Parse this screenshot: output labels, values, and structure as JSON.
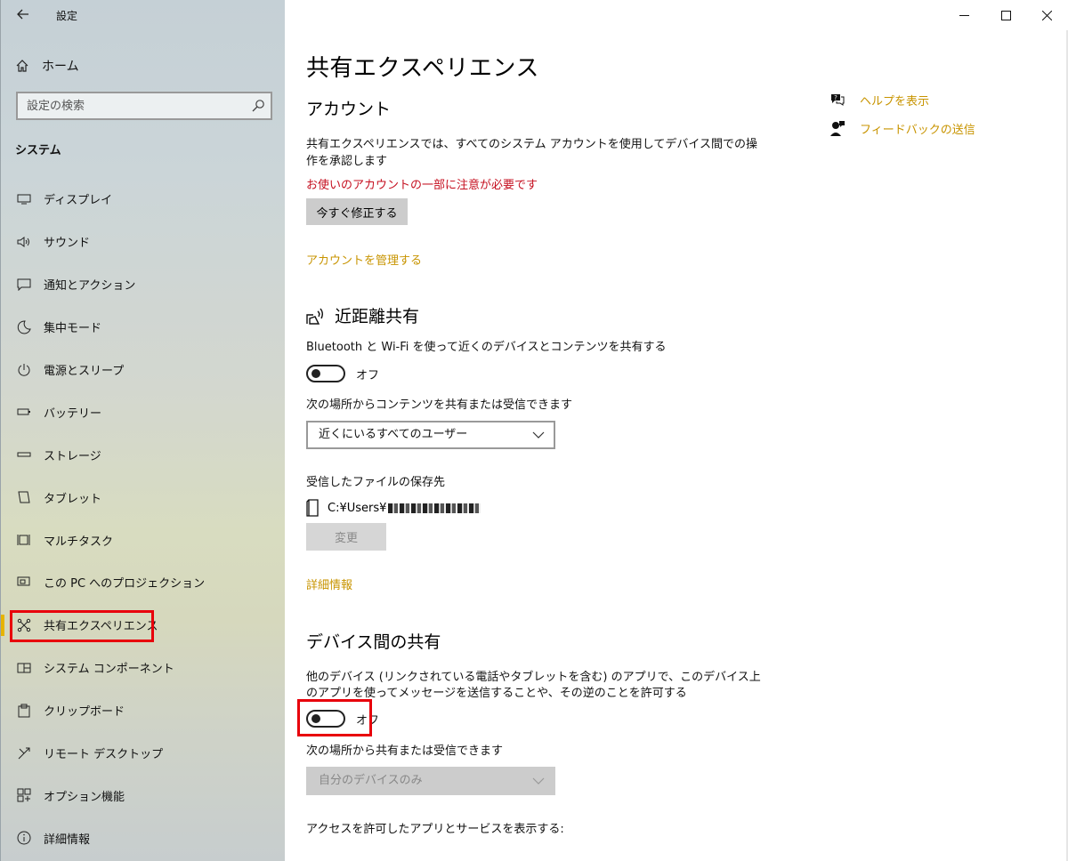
{
  "window": {
    "title": "設定"
  },
  "sidebar": {
    "home_label": "ホーム",
    "search_placeholder": "設定の検索",
    "section_title": "システム",
    "items": [
      {
        "label": "ディスプレイ",
        "icon": "display-icon"
      },
      {
        "label": "サウンド",
        "icon": "speaker-icon"
      },
      {
        "label": "通知とアクション",
        "icon": "notification-icon"
      },
      {
        "label": "集中モード",
        "icon": "moon-icon"
      },
      {
        "label": "電源とスリープ",
        "icon": "power-icon"
      },
      {
        "label": "バッテリー",
        "icon": "battery-icon"
      },
      {
        "label": "ストレージ",
        "icon": "storage-icon"
      },
      {
        "label": "タブレット",
        "icon": "tablet-icon"
      },
      {
        "label": "マルチタスク",
        "icon": "multitask-icon"
      },
      {
        "label": "この PC へのプロジェクション",
        "icon": "projection-icon"
      },
      {
        "label": "共有エクスペリエンス",
        "icon": "shared-experience-icon"
      },
      {
        "label": "システム コンポーネント",
        "icon": "component-icon"
      },
      {
        "label": "クリップボード",
        "icon": "clipboard-icon"
      },
      {
        "label": "リモート デスクトップ",
        "icon": "remote-desktop-icon"
      },
      {
        "label": "オプション機能",
        "icon": "optional-features-icon"
      },
      {
        "label": "詳細情報",
        "icon": "info-icon"
      }
    ],
    "active_index": 10
  },
  "main": {
    "title": "共有エクスペリエンス",
    "account": {
      "heading": "アカウント",
      "description": "共有エクスペリエンスでは、すべてのシステム アカウントを使用してデバイス間での操作を承認します",
      "description_line1": "共有エクスペリエンスでは、すべてのシステム アカウントを使用してデバイス間での操",
      "description_line2": "作を承認します",
      "warning": "お使いのアカウントの一部に注意が必要です",
      "fix_button": "今すぐ修正する",
      "manage_link": "アカウントを管理する"
    },
    "nearby": {
      "heading": "近距離共有",
      "description": "Bluetooth と Wi-Fi を使って近くのデバイスとコンテンツを共有する",
      "toggle_state": "オフ",
      "share_from_label": "次の場所からコンテンツを共有または受信できます",
      "share_from_value": "近くにいるすべてのユーザー",
      "save_location_label": "受信したファイルの保存先",
      "save_path": "C:¥Users¥",
      "change_button": "変更",
      "details_link": "詳細情報"
    },
    "cross_device": {
      "heading": "デバイス間の共有",
      "description_line1": "他のデバイス (リンクされている電話やタブレットを含む) のアプリで、このデバイス上",
      "description_line2": "のアプリを使ってメッセージを送信することや、その逆のことを許可する",
      "toggle_state": "オフ",
      "share_from_label": "次の場所から共有または受信できます",
      "share_from_value": "自分のデバイスのみ",
      "apps_label": "アクセスを許可したアプリとサービスを表示する:"
    },
    "help": {
      "show_help": "ヘルプを表示",
      "feedback": "フィードバックの送信"
    }
  }
}
